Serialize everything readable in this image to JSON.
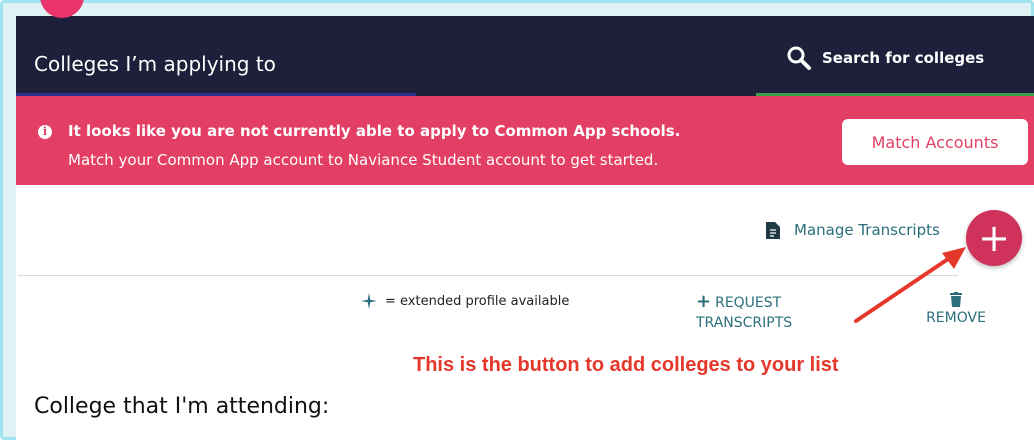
{
  "header": {
    "title": "Colleges I’m applying to",
    "search_label": "Search for colleges"
  },
  "alert": {
    "icon": "info-circle-icon",
    "line1": "It looks like you are not currently able to apply to Common App schools.",
    "line2": "Match your Common App account to Naviance Student account to get started.",
    "match_label": "Match Accounts"
  },
  "toolbar": {
    "manage_transcripts_label": "Manage Transcripts",
    "add_icon": "plus-icon"
  },
  "list_actions": {
    "legend_text": "= extended profile available",
    "request_label": "REQUEST TRANSCRIPTS",
    "remove_label": "REMOVE"
  },
  "annotation": {
    "text": "This is the button to add colleges to your list"
  },
  "sections": {
    "attending_title": "College that I'm attending:"
  },
  "colors": {
    "header_bg": "#1d1f3b",
    "alert_bg": "#e33e64",
    "add_button": "#cf335c",
    "link_teal": "#2a6f7b",
    "annotation_red": "#e5382b",
    "frame_cyan": "#9fe3ee"
  }
}
